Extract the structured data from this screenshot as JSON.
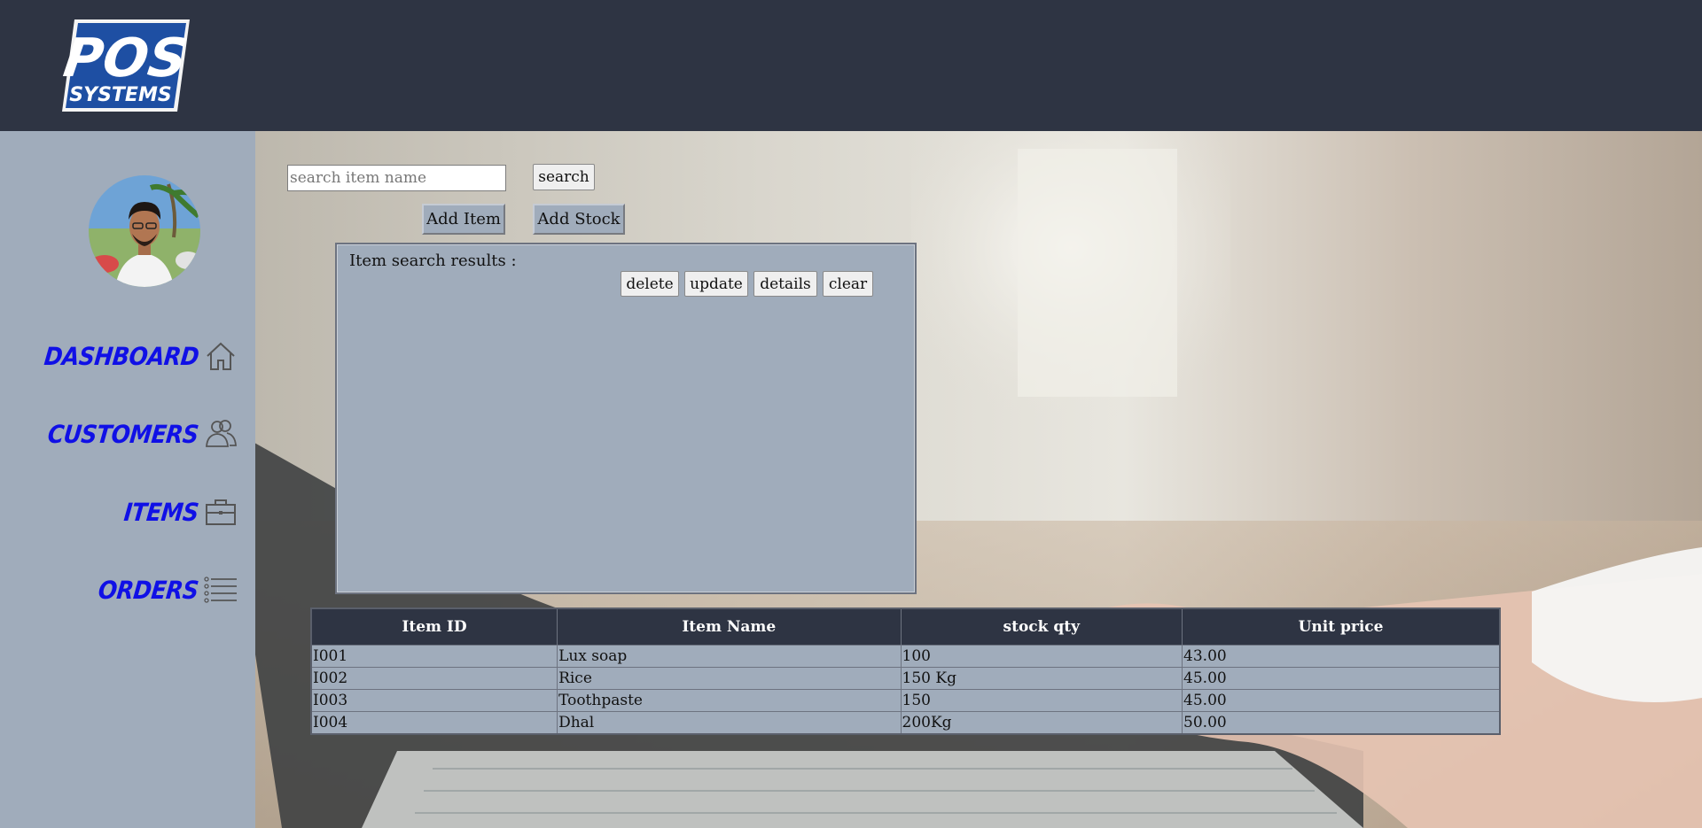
{
  "header": {
    "logo_top": "POS",
    "logo_bottom": "SYSTEMS"
  },
  "sidebar": {
    "items": [
      {
        "label": "DASHBOARD",
        "icon": "home-icon"
      },
      {
        "label": "CUSTOMERS",
        "icon": "users-icon"
      },
      {
        "label": "ITEMS",
        "icon": "briefcase-icon"
      },
      {
        "label": "ORDERS",
        "icon": "list-icon"
      }
    ]
  },
  "toolbar": {
    "search_placeholder": "search item name",
    "search_value": "",
    "search_label": "search",
    "add_item_label": "Add Item",
    "add_stock_label": "Add Stock"
  },
  "results": {
    "title": "Item search results :",
    "delete_label": "delete",
    "update_label": "update",
    "details_label": "details",
    "clear_label": "clear"
  },
  "table": {
    "headers": [
      "Item ID",
      "Item Name",
      "stock qty",
      "Unit price"
    ],
    "rows": [
      [
        "I001",
        "Lux soap",
        "100",
        "43.00"
      ],
      [
        "I002",
        "Rice",
        "150 Kg",
        "45.00"
      ],
      [
        "I003",
        "Toothpaste",
        "150",
        "45.00"
      ],
      [
        "I004",
        "Dhal",
        "200Kg",
        "50.00"
      ]
    ]
  },
  "colors": {
    "header_bg": "#2e3443",
    "sidebar_bg": "#a0acbb",
    "nav_text": "#1010e6",
    "logo_blue": "#1e4fa3"
  }
}
